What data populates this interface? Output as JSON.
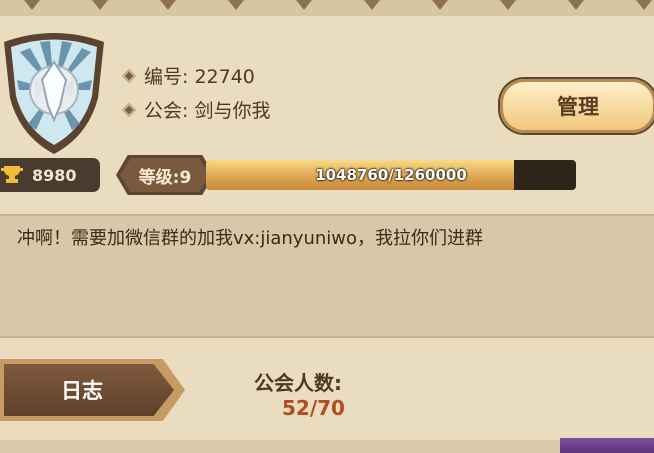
{
  "guild": {
    "id_label": "编号:",
    "id_value": "22740",
    "name_label": "公会:",
    "name_value": "剑与你我",
    "manage_label": "管理"
  },
  "trophies": "8980",
  "level": {
    "label": "等级:9",
    "progress_text": "1048760/1260000",
    "current": 1048760,
    "max": 1260000
  },
  "announcement": "冲啊！需要加微信群的加我vx:jianyuniwo，我拉你们进群",
  "log_label": "日志",
  "members": {
    "label": "公会人数:",
    "count": "52/70"
  },
  "colors": {
    "accent": "#b34b25",
    "panel": "#d8c8a9",
    "background": "#e9dcbf"
  }
}
